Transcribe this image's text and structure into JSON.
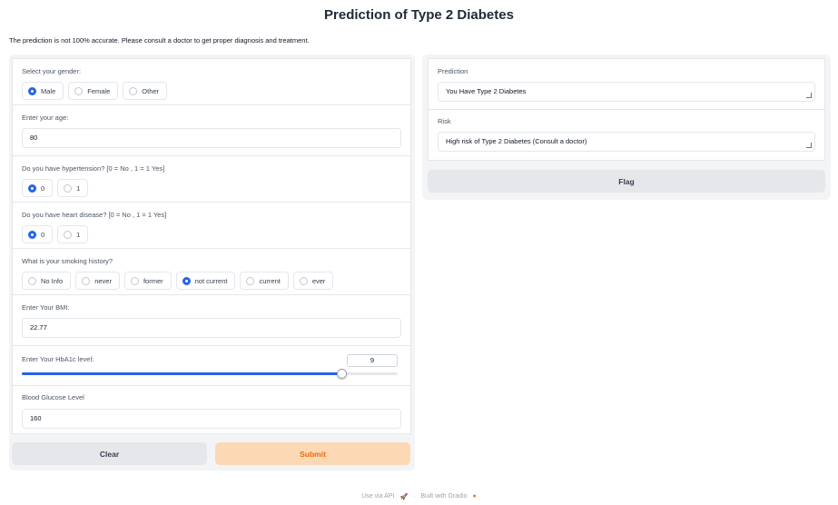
{
  "title": "Prediction of Type 2 Diabetes",
  "disclaimer": "The prediction is not 100% accurate. Please consult a doctor to get proper diagnosis and treatment.",
  "form": {
    "gender": {
      "label": "Select your gender:",
      "options": [
        "Male",
        "Female",
        "Other"
      ],
      "selected": "Male"
    },
    "age": {
      "label": "Enter your age:",
      "value": "80"
    },
    "hypertension": {
      "label": "Do you have hypertension? [0 = No , 1 = 1 Yes]",
      "options": [
        "0",
        "1"
      ],
      "selected": "0"
    },
    "heart_disease": {
      "label": "Do you have heart disease? [0 = No , 1 = 1 Yes]",
      "options": [
        "0",
        "1"
      ],
      "selected": "0"
    },
    "smoking": {
      "label": "What is your smoking history?",
      "options": [
        "No Info",
        "never",
        "former",
        "not current",
        "current",
        "ever"
      ],
      "selected": "not current"
    },
    "bmi": {
      "label": "Enter Your BMI:",
      "value": "22.77"
    },
    "hba1c": {
      "label": "Enter Your HbA1c level:",
      "value": "9",
      "slider_fraction": 0.85
    },
    "glucose": {
      "label": "Blood Glucose Level",
      "value": "160"
    }
  },
  "buttons": {
    "clear": "Clear",
    "submit": "Submit",
    "flag": "Flag"
  },
  "output": {
    "prediction": {
      "label": "Prediction",
      "value": "You Have Type 2 Diabetes"
    },
    "risk": {
      "label": "Risk",
      "value": "High risk of Type 2 Diabetes (Consult a doctor)"
    }
  },
  "footer": {
    "api": "Use via API",
    "separator": "·",
    "built": "Built with Gradio"
  },
  "colors": {
    "accent": "#2563eb",
    "primary_button": "#fdd8b5",
    "primary_text": "#ea6b0c"
  }
}
